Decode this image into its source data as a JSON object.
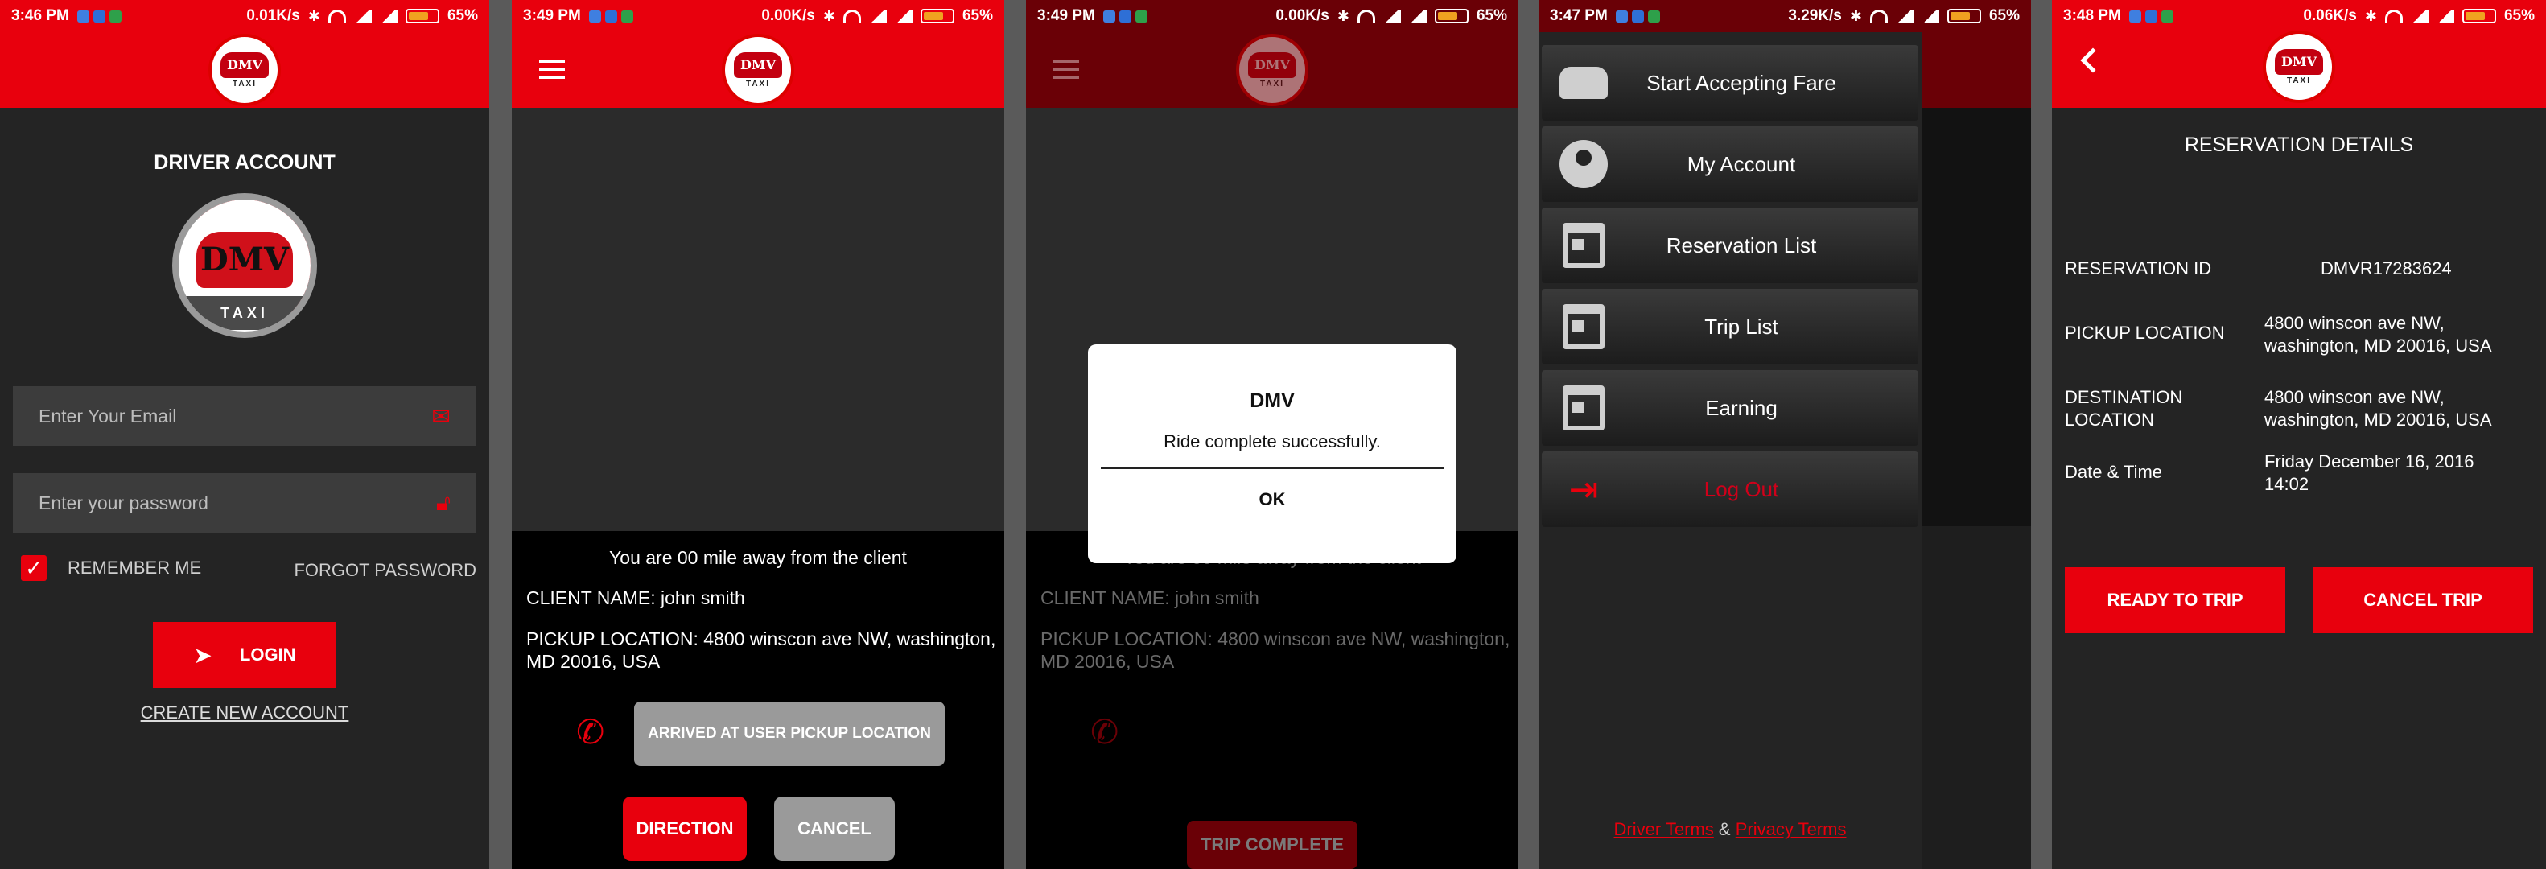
{
  "status": {
    "s1": {
      "time": "3:46 PM",
      "speed": "0.01K/s",
      "battery": "65%"
    },
    "s2": {
      "time": "3:49 PM",
      "speed": "0.00K/s",
      "battery": "65%"
    },
    "s3": {
      "time": "3:49 PM",
      "speed": "0.00K/s",
      "battery": "65%"
    },
    "s4": {
      "time": "3:47 PM",
      "speed": "3.29K/s",
      "battery": "65%"
    },
    "s5": {
      "time": "3:48 PM",
      "speed": "0.06K/s",
      "battery": "65%"
    }
  },
  "logo": {
    "brand": "DMV",
    "sub": "TAXI"
  },
  "login": {
    "title": "DRIVER ACCOUNT",
    "email_placeholder": "Enter Your Email",
    "password_placeholder": "Enter your password",
    "remember": "REMEMBER ME",
    "forgot": "FORGOT PASSWORD",
    "login_button": "LOGIN",
    "create_account": "CREATE NEW ACCOUNT"
  },
  "pickup": {
    "away": "You are 00 mile away from the client",
    "client": "CLIENT NAME: john smith",
    "location": "PICKUP LOCATION: 4800 winscon ave NW, washington, MD 20016, USA",
    "arrived_button": "ARRIVED AT USER PICKUP LOCATION",
    "direction_button": "DIRECTION",
    "cancel_button": "CANCEL"
  },
  "dialog": {
    "title": "DMV",
    "message": "Ride complete successfully.",
    "ok": "OK",
    "trip_complete": "TRIP COMPLETE"
  },
  "drawer": {
    "items": [
      {
        "label": "Start Accepting Fare",
        "icon": "car-icon"
      },
      {
        "label": "My Account",
        "icon": "account-icon"
      },
      {
        "label": "Reservation List",
        "icon": "calendar-icon"
      },
      {
        "label": "Trip List",
        "icon": "calendar-icon"
      },
      {
        "label": "Earning",
        "icon": "calendar-icon"
      },
      {
        "label": "Log Out",
        "icon": "logout-icon"
      }
    ],
    "driver_terms": "Driver Terms",
    "amp": "&",
    "privacy_terms": "Privacy Terms"
  },
  "reservation": {
    "title": "RESERVATION DETAILS",
    "id_label": "RESERVATION ID",
    "id_value": "DMVR17283624",
    "pickup_label": "PICKUP LOCATION",
    "pickup_value": "4800 winscon ave NW, washington, MD 20016, USA",
    "dest_label": "DESTINATION LOCATION",
    "dest_value": "4800 winscon ave NW, washington, MD 20016, USA",
    "date_label": "Date & Time",
    "date_value": "Friday December 16, 2016 14:02",
    "ready_button": "READY TO TRIP",
    "cancel_button": "CANCEL TRIP"
  },
  "colors": {
    "brand_red": "#e8000d",
    "dark": "#242424"
  }
}
